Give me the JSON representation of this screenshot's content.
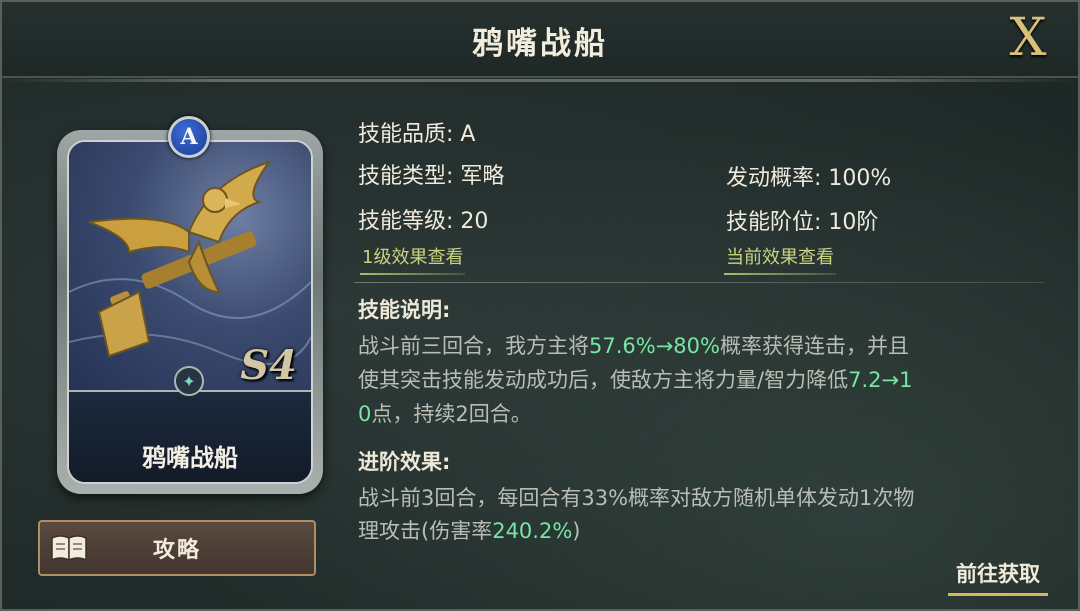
{
  "title": "鸦嘴战船",
  "close_label": "X",
  "card": {
    "name": "鸦嘴战船",
    "grade": "A",
    "level_mark": "S4"
  },
  "guide_button": {
    "label": "攻略"
  },
  "info": {
    "quality": "技能品质: A",
    "type": "技能类型: 军略",
    "level": "技能等级: 20",
    "trigger_rate": "发动概率: 100%",
    "rank": "技能阶位: 10阶",
    "level1_link": "1级效果查看",
    "current_link": "当前效果查看"
  },
  "description": {
    "title": "技能说明:",
    "line1_a": "战斗前三回合，我方主将",
    "line1_hl": "57.6%→80%",
    "line1_b": "概率获得连击，并且",
    "line2_a": "使其突击技能发动成功后，使敌方主将力量/智力降低",
    "line2_hl": "7.2→1",
    "line3_hl": "0",
    "line3_b": "点，持续2回合。"
  },
  "advance": {
    "title": "进阶效果:",
    "line1": "战斗前3回合，每回合有33%概率对敌方随机单体发动1次物",
    "line2_a": "理攻击(伤害率",
    "line2_hl": "240.2%",
    "line2_b": ")"
  },
  "goto_button": {
    "label": "前往获取"
  },
  "colors": {
    "highlight": "#76e6a2",
    "link": "#c7d37f",
    "gold": "#d9b65a"
  }
}
